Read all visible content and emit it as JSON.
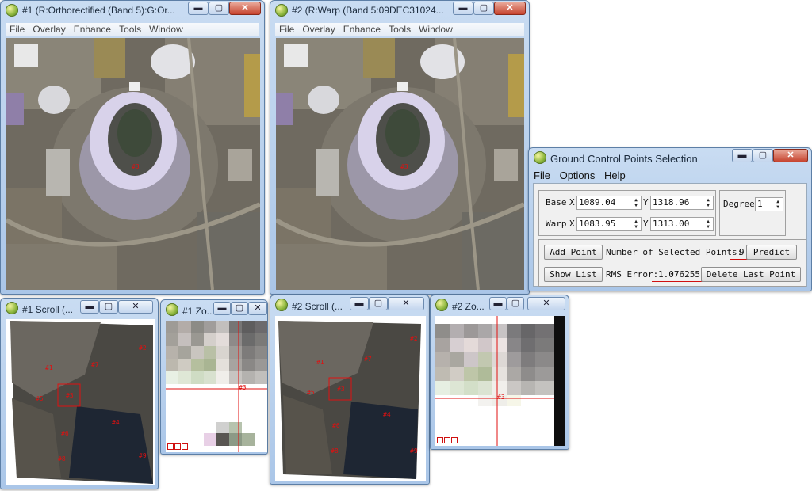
{
  "windows": {
    "image1": {
      "title": "#1 (R:Orthorectified (Band 5):G:Or..."
    },
    "image2": {
      "title": "#2 (R:Warp (Band 5:09DEC31024..."
    },
    "scroll1": {
      "title": "#1 Scroll (..."
    },
    "zoom1": {
      "title": "#1 Zo..."
    },
    "scroll2": {
      "title": "#2 Scroll (..."
    },
    "zoom2": {
      "title": "#2 Zo..."
    }
  },
  "image_menu": [
    "File",
    "Overlay",
    "Enhance",
    "Tools",
    "Window"
  ],
  "window_buttons": {
    "minimize": "▬",
    "maximize": "▢",
    "close": "✕"
  },
  "markers": {
    "image1": "#3",
    "image2": "#3",
    "zoom1": "#3",
    "zoom2": "#3",
    "scroll1": [
      "#2",
      "#1",
      "#3",
      "#7",
      "#5",
      "#6",
      "#4",
      "#8",
      "#9"
    ],
    "scroll2": [
      "#2",
      "#1",
      "#3",
      "#7",
      "#5",
      "#6",
      "#4",
      "#8",
      "#9"
    ]
  },
  "gcp": {
    "title": "Ground Control Points Selection",
    "menu": [
      "File",
      "Options",
      "Help"
    ],
    "base_label": "Base",
    "warp_label": "Warp",
    "x_label": "X",
    "y_label": "Y",
    "base_x": "1089.04",
    "base_y": "1318.96",
    "warp_x": "1083.95",
    "warp_y": "1313.00",
    "degree_label": "Degree",
    "degree_value": "1",
    "add_point": "Add Point",
    "num_points_label": "Number of Selected Points:",
    "num_points": "9",
    "predict": "Predict",
    "show_list": "Show List",
    "rms_label": "RMS Error:",
    "rms_value": "1.076255",
    "delete_last": "Delete Last Point"
  },
  "colors": {
    "marker": "#e01010",
    "underline": "#d01010"
  }
}
